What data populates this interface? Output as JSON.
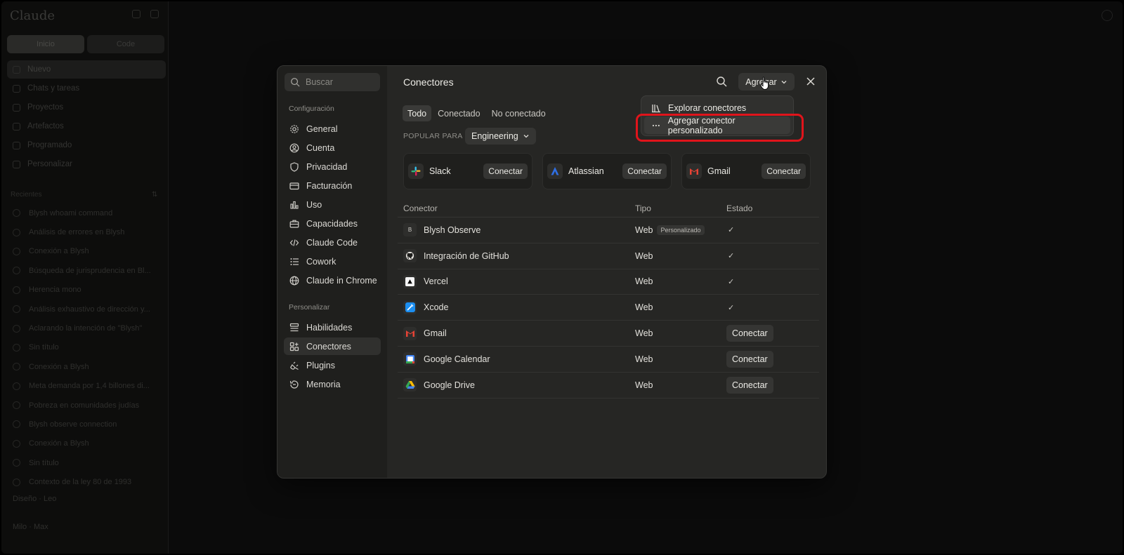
{
  "app": {
    "brand": "Claude",
    "seg": [
      "Inicio",
      "Code"
    ],
    "nav": [
      "Nuevo",
      "Chats y tareas",
      "Proyectos",
      "Artefactos",
      "Programado",
      "Personalizar"
    ],
    "recents_label": "Recientes",
    "recents": [
      "Blysh whoami command",
      "Análisis de errores en Blysh",
      "Conexión a Blysh",
      "Búsqueda de jurisprudencia en Bl...",
      "Herencia mono",
      "Análisis exhaustivo de dirección y...",
      "Aclarando la intención de \"Blysh\"",
      "Sin título",
      "Conexión a Blysh",
      "Meta demanda por 1,4 billones di...",
      "Pobreza en comunidades judías",
      "Blysh observe connection",
      "Conexión a Blysh",
      "Sin título",
      "Contexto de la ley 80 de 1993"
    ],
    "design_row": "Diseño  ·  Leo",
    "user_row": "Milo · Max"
  },
  "modal": {
    "search_placeholder": "Buscar",
    "section_config": "Configuración",
    "config_items": [
      "General",
      "Cuenta",
      "Privacidad",
      "Facturación",
      "Uso",
      "Capacidades",
      "Claude Code",
      "Cowork",
      "Claude in Chrome"
    ],
    "section_personalize": "Personalizar",
    "personalize_items": [
      "Habilidades",
      "Conectores",
      "Plugins",
      "Memoria"
    ],
    "title": "Conectores",
    "add_label": "Agregar",
    "tabs": [
      "Todo",
      "Conectado",
      "No conectado"
    ],
    "popular_label": "POPULAR PARA",
    "popular_value": "Engineering",
    "cards": [
      {
        "name": "Slack",
        "button": "Conectar"
      },
      {
        "name": "Atlassian",
        "button": "Conectar"
      },
      {
        "name": "Gmail",
        "button": "Conectar"
      }
    ],
    "table": {
      "headers": [
        "Conector",
        "Tipo",
        "Estado"
      ],
      "rows": [
        {
          "name": "Blysh Observe",
          "type": "Web",
          "badge": "Personalizado",
          "status": "✓"
        },
        {
          "name": "Integración de GitHub",
          "type": "Web",
          "badge": "",
          "status": "✓"
        },
        {
          "name": "Vercel",
          "type": "Web",
          "badge": "",
          "status": "✓"
        },
        {
          "name": "Xcode",
          "type": "Web",
          "badge": "",
          "status": "✓"
        },
        {
          "name": "Gmail",
          "type": "Web",
          "badge": "",
          "status": "Conectar"
        },
        {
          "name": "Google Calendar",
          "type": "Web",
          "badge": "",
          "status": "Conectar"
        },
        {
          "name": "Google Drive",
          "type": "Web",
          "badge": "",
          "status": "Conectar"
        }
      ]
    },
    "blysh_icon_letter": "B"
  },
  "dropdown": {
    "items": [
      "Explorar conectores",
      "Agregar conector personalizado"
    ]
  },
  "colors": {
    "highlight": "#e0141b",
    "modal_bg": "#262624",
    "sidebar_bg": "#1f1f1d"
  }
}
